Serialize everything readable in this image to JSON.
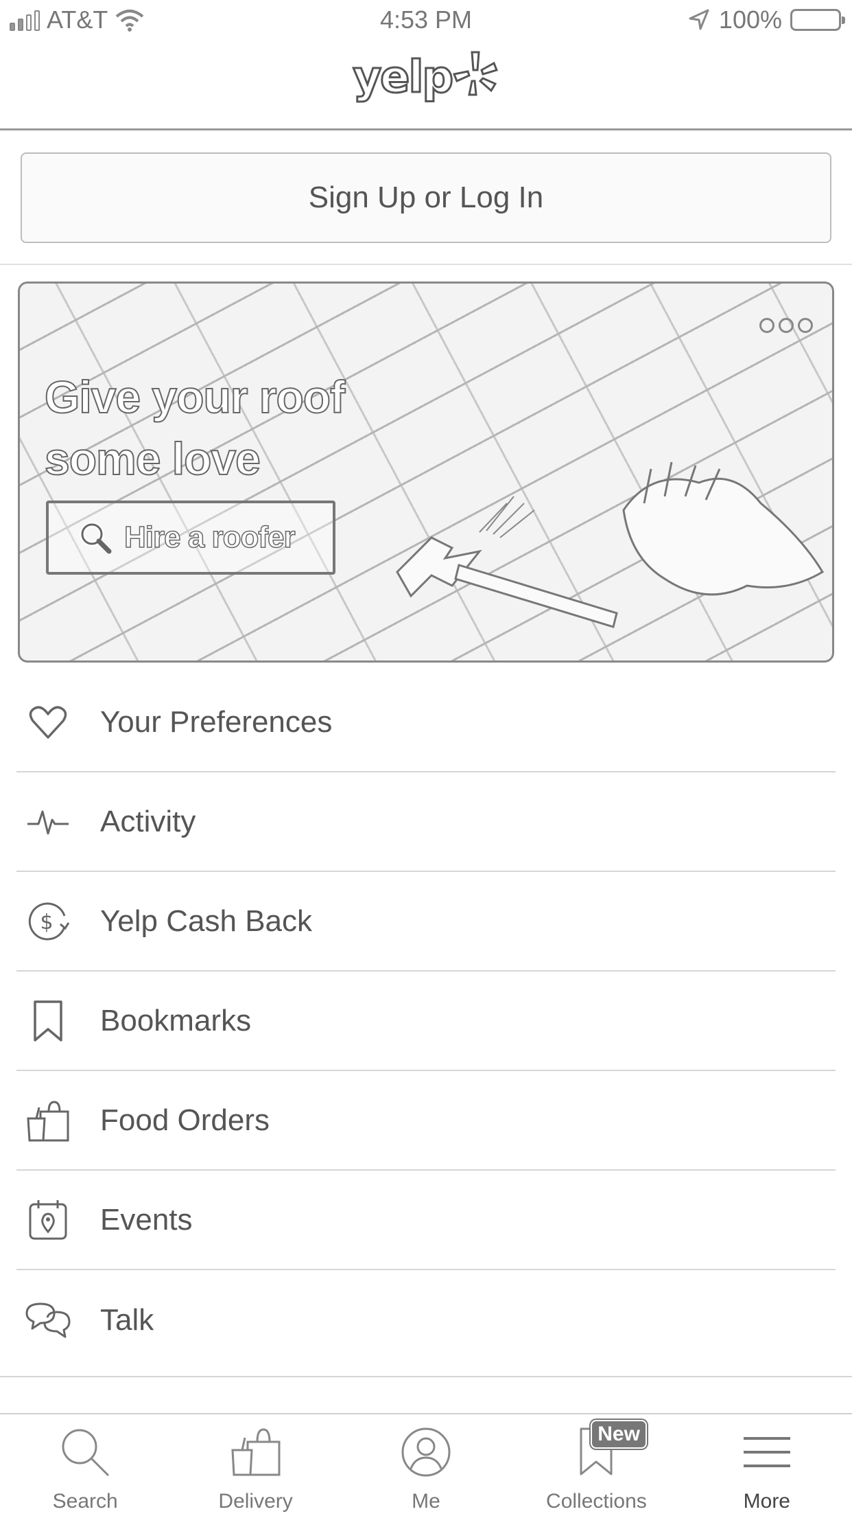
{
  "status_bar": {
    "carrier": "AT&T",
    "time": "4:53 PM",
    "battery": "100%"
  },
  "header": {
    "logo_text": "yelp"
  },
  "signin": {
    "label": "Sign Up or Log In"
  },
  "promo": {
    "title_line1": "Give your roof",
    "title_line2": "some love",
    "cta_label": "Hire a roofer"
  },
  "menu": {
    "items": [
      {
        "label": "Your Preferences",
        "icon": "heart-icon"
      },
      {
        "label": "Activity",
        "icon": "activity-icon"
      },
      {
        "label": "Yelp Cash Back",
        "icon": "cash-back-icon"
      },
      {
        "label": "Bookmarks",
        "icon": "bookmark-icon"
      },
      {
        "label": "Food Orders",
        "icon": "food-bag-icon"
      },
      {
        "label": "Events",
        "icon": "calendar-icon"
      },
      {
        "label": "Talk",
        "icon": "chat-bubbles-icon"
      }
    ]
  },
  "tabbar": {
    "tabs": [
      {
        "label": "Search",
        "icon": "search-icon"
      },
      {
        "label": "Delivery",
        "icon": "delivery-icon"
      },
      {
        "label": "Me",
        "icon": "profile-icon"
      },
      {
        "label": "Collections",
        "icon": "collections-icon",
        "badge": "New"
      },
      {
        "label": "More",
        "icon": "hamburger-icon",
        "active": true
      }
    ]
  }
}
